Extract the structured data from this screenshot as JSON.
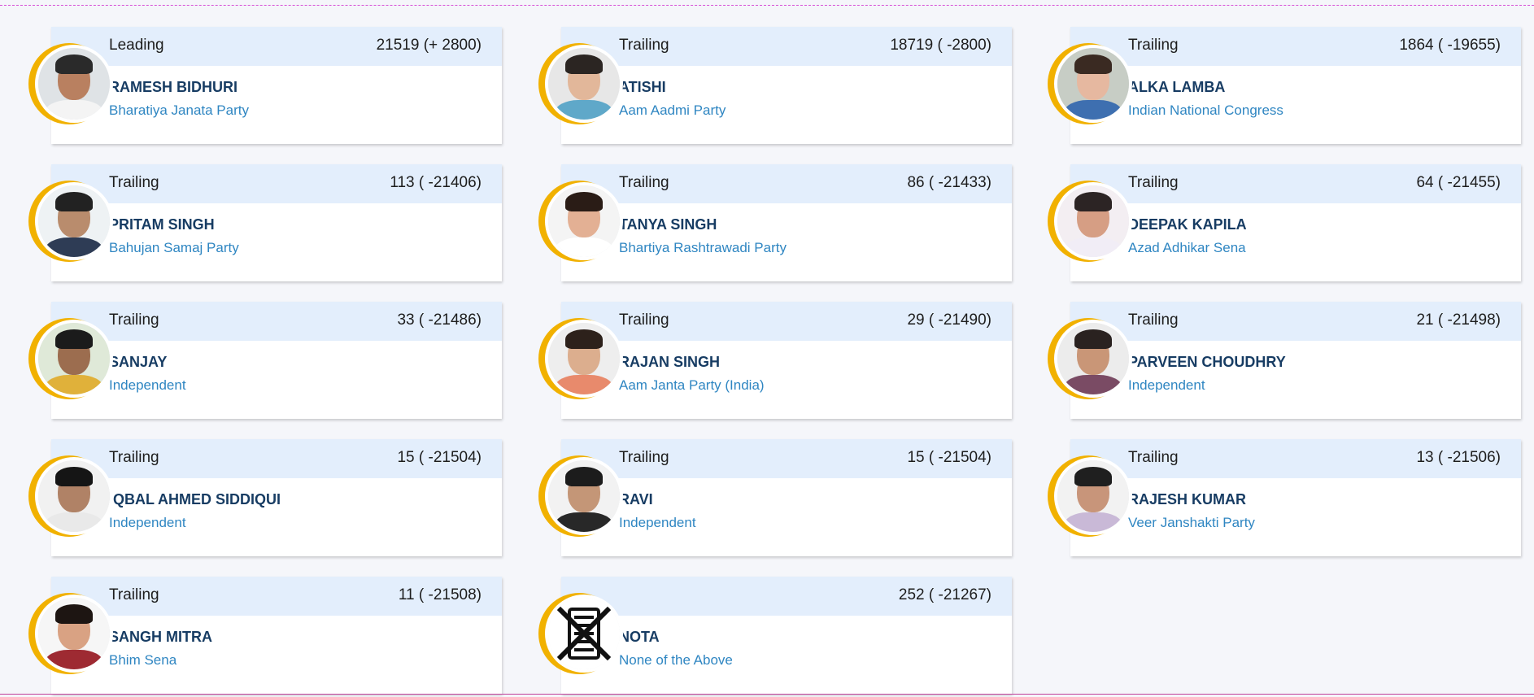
{
  "candidates": [
    {
      "status": "Leading",
      "votes": "21519 (+ 2800)",
      "name": "RAMESH BIDHURI",
      "party": "Bharatiya Janata Party",
      "photo": "candidate-photo",
      "skin": "#b98060",
      "hair": "#2a2a2a",
      "shirt": "#f4f4f4",
      "bg": "#dfe3e6"
    },
    {
      "status": "Trailing",
      "votes": "18719 ( -2800)",
      "name": "ATISHI",
      "party": "Aam Aadmi Party",
      "photo": "candidate-photo",
      "skin": "#e2b79a",
      "hair": "#2b2522",
      "shirt": "#5fa8c9",
      "bg": "#e7e7e7"
    },
    {
      "status": "Trailing",
      "votes": "1864 ( -19655)",
      "name": "ALKA LAMBA",
      "party": "Indian National Congress",
      "photo": "candidate-photo",
      "skin": "#e6b8a0",
      "hair": "#3a2a22",
      "shirt": "#3e6fb0",
      "bg": "#c7cdc5"
    },
    {
      "status": "Trailing",
      "votes": "113 ( -21406)",
      "name": "PRITAM SINGH",
      "party": "Bahujan Samaj Party",
      "photo": "candidate-photo",
      "skin": "#b98c6d",
      "hair": "#222222",
      "shirt": "#2e3c55",
      "bg": "#eef2f4"
    },
    {
      "status": "Trailing",
      "votes": "86 ( -21433)",
      "name": "TANYA SINGH",
      "party": "Bhartiya Rashtrawadi Party",
      "photo": "candidate-photo",
      "skin": "#e3b094",
      "hair": "#2a1c16",
      "shirt": "#ffffff",
      "bg": "#f4f4f4"
    },
    {
      "status": "Trailing",
      "votes": "64 ( -21455)",
      "name": "DEEPAK KAPILA",
      "party": "Azad Adhikar Sena",
      "photo": "candidate-photo",
      "skin": "#d69e84",
      "hair": "#2c2424",
      "shirt": "#f1edf6",
      "bg": "#f3eef2"
    },
    {
      "status": "Trailing",
      "votes": "33 ( -21486)",
      "name": "SANJAY",
      "party": "Independent",
      "photo": "candidate-photo",
      "skin": "#9c6d4f",
      "hair": "#1b1b1b",
      "shirt": "#e0b13a",
      "bg": "#dfe9d8"
    },
    {
      "status": "Trailing",
      "votes": "29 ( -21490)",
      "name": "RAJAN SINGH",
      "party": "Aam Janta Party (India)",
      "photo": "candidate-photo",
      "skin": "#dcae8e",
      "hair": "#2d211b",
      "shirt": "#e88a6c",
      "bg": "#eeeeee"
    },
    {
      "status": "Trailing",
      "votes": "21 ( -21498)",
      "name": "PARVEEN CHOUDHRY",
      "party": "Independent",
      "photo": "candidate-photo",
      "skin": "#c99677",
      "hair": "#2a2220",
      "shirt": "#7a4b64",
      "bg": "#ececec"
    },
    {
      "status": "Trailing",
      "votes": "15 ( -21504)",
      "name": "IQBAL AHMED SIDDIQUI",
      "party": "Independent",
      "photo": "candidate-photo",
      "skin": "#b08266",
      "hair": "#151515",
      "shirt": "#e9e9e9",
      "bg": "#f1f1f1"
    },
    {
      "status": "Trailing",
      "votes": "15 ( -21504)",
      "name": "RAVI",
      "party": "Independent",
      "photo": "candidate-photo",
      "skin": "#c49677",
      "hair": "#1c1c1c",
      "shirt": "#282828",
      "bg": "#f2f2f2"
    },
    {
      "status": "Trailing",
      "votes": "13 ( -21506)",
      "name": "RAJESH KUMAR",
      "party": "Veer Janshakti Party",
      "photo": "candidate-photo",
      "skin": "#c8957a",
      "hair": "#1f1f1f",
      "shirt": "#c9b9d7",
      "bg": "#f2f2f2"
    },
    {
      "status": "Trailing",
      "votes": "11 ( -21508)",
      "name": "SANGH MITRA",
      "party": "Bhim Sena",
      "photo": "candidate-photo",
      "skin": "#d9a283",
      "hair": "#1d1512",
      "shirt": "#9e2a32",
      "bg": "#f6f6f6"
    },
    {
      "status": "",
      "votes": "252 ( -21267)",
      "name": "NOTA",
      "party": "None of the Above",
      "photo": "nota-icon"
    }
  ],
  "colors": {
    "accent_ring": "#f1b100",
    "header_bg": "#e3eefc",
    "name": "#173c63",
    "party": "#2f86c2"
  }
}
